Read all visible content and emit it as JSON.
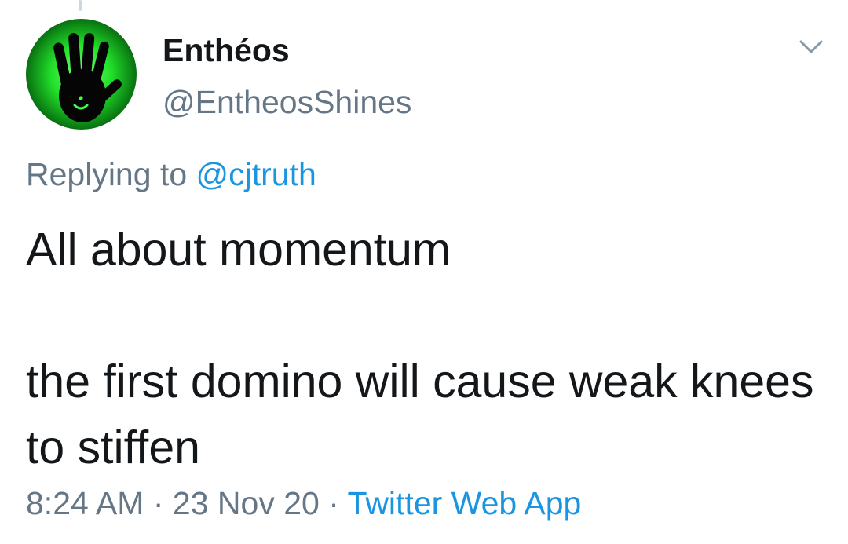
{
  "tweet": {
    "display_name": "Enthéos",
    "handle": "@EntheosShines",
    "avatar_icon": "glowing-hand-avatar",
    "replying_prefix": "Replying to",
    "replying_to": "@cjtruth",
    "text_line1": "All about momentum",
    "text_line2": "the first domino will cause weak knees to stiffen",
    "time": "8:24 AM",
    "separator": "·",
    "date": "23 Nov 20",
    "source": "Twitter Web App"
  },
  "colors": {
    "primary_text": "#14171a",
    "secondary_text": "#657786",
    "link": "#1b95e0",
    "avatar_glow": "#2bff3a"
  }
}
